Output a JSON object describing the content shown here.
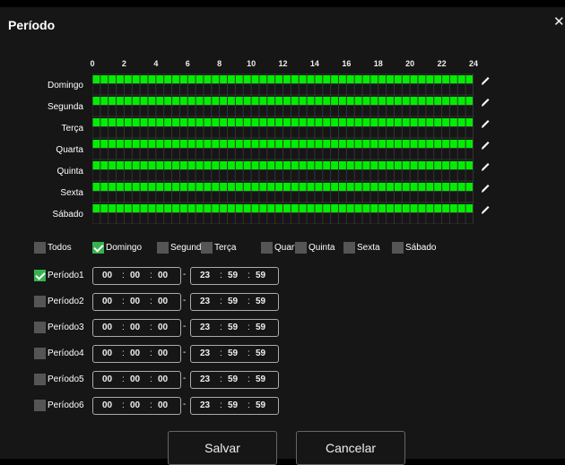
{
  "dialog": {
    "title": "Período",
    "close_icon": "✕"
  },
  "hours": [
    "0",
    "2",
    "4",
    "6",
    "8",
    "10",
    "12",
    "14",
    "16",
    "18",
    "20",
    "22",
    "24"
  ],
  "days": [
    {
      "label": "Domingo",
      "filled_fraction": 1.0
    },
    {
      "label": "Segunda",
      "filled_fraction": 1.0
    },
    {
      "label": "Terça",
      "filled_fraction": 1.0
    },
    {
      "label": "Quarta",
      "filled_fraction": 1.0
    },
    {
      "label": "Quinta",
      "filled_fraction": 1.0
    },
    {
      "label": "Sexta",
      "filled_fraction": 1.0
    },
    {
      "label": "Sábado",
      "filled_fraction": 1.0
    }
  ],
  "day_checks": [
    {
      "label": "Todos",
      "checked": false
    },
    {
      "label": "Domingo",
      "checked": true
    },
    {
      "label": "Segunda",
      "checked": false
    },
    {
      "label": "Terça",
      "checked": false
    },
    {
      "label": "Quarta",
      "checked": false
    },
    {
      "label": "Quinta",
      "checked": false
    },
    {
      "label": "Sexta",
      "checked": false
    },
    {
      "label": "Sábado",
      "checked": false
    }
  ],
  "periods": [
    {
      "label": "Período1",
      "checked": true,
      "start": [
        "00",
        "00",
        "00"
      ],
      "end": [
        "23",
        "59",
        "59"
      ]
    },
    {
      "label": "Período2",
      "checked": false,
      "start": [
        "00",
        "00",
        "00"
      ],
      "end": [
        "23",
        "59",
        "59"
      ]
    },
    {
      "label": "Período3",
      "checked": false,
      "start": [
        "00",
        "00",
        "00"
      ],
      "end": [
        "23",
        "59",
        "59"
      ]
    },
    {
      "label": "Período4",
      "checked": false,
      "start": [
        "00",
        "00",
        "00"
      ],
      "end": [
        "23",
        "59",
        "59"
      ]
    },
    {
      "label": "Período5",
      "checked": false,
      "start": [
        "00",
        "00",
        "00"
      ],
      "end": [
        "23",
        "59",
        "59"
      ]
    },
    {
      "label": "Período6",
      "checked": false,
      "start": [
        "00",
        "00",
        "00"
      ],
      "end": [
        "23",
        "59",
        "59"
      ]
    }
  ],
  "separator": ":",
  "range_dash": "-",
  "buttons": {
    "save": "Salvar",
    "cancel": "Cancelar"
  },
  "colors": {
    "schedule_fill": "#00ee00",
    "grid_line": "#333333",
    "check_on": "#36b24f",
    "check_off": "#555555"
  }
}
